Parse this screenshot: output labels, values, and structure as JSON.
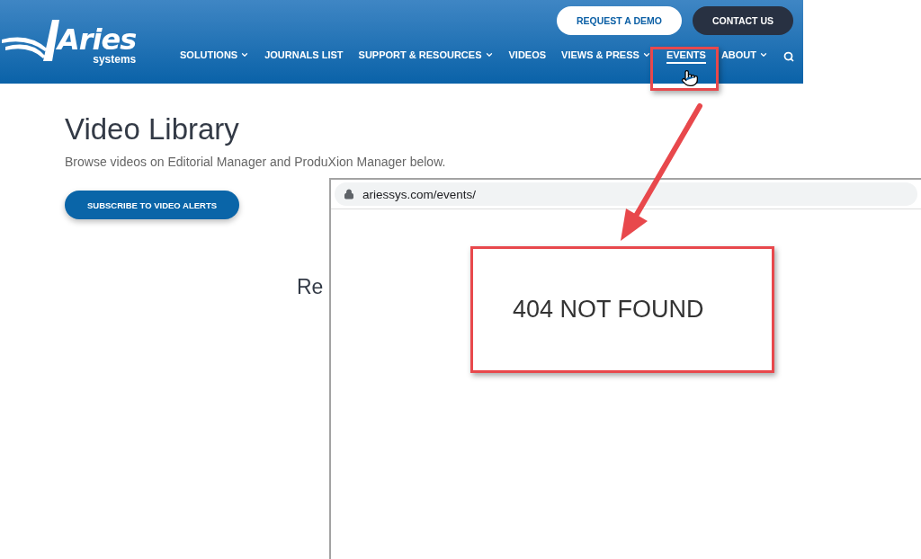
{
  "header": {
    "logo": {
      "name": "Aries",
      "tagline": "systems"
    },
    "buttons": [
      {
        "label": "REQUEST A DEMO",
        "kind": "light"
      },
      {
        "label": "CONTACT US",
        "kind": "dark"
      }
    ],
    "nav": [
      {
        "label": "SOLUTIONS",
        "dropdown": true,
        "selected": false
      },
      {
        "label": "JOURNALS LIST",
        "dropdown": false,
        "selected": false
      },
      {
        "label": "SUPPORT & RESOURCES",
        "dropdown": true,
        "selected": false
      },
      {
        "label": "VIDEOS",
        "dropdown": false,
        "selected": false
      },
      {
        "label": "VIEWS & PRESS",
        "dropdown": true,
        "selected": false
      },
      {
        "label": "EVENTS",
        "dropdown": false,
        "selected": true
      },
      {
        "label": "ABOUT",
        "dropdown": true,
        "selected": false
      }
    ]
  },
  "page": {
    "title": "Video Library",
    "subtitle": "Browse videos on Editorial Manager and ProduXion Manager below.",
    "button": "SUBSCRIBE TO VIDEO ALERTS",
    "section_heading": "Re"
  },
  "popup_window": {
    "url": "ariessys.com/events/",
    "message": "404 NOT FOUND"
  }
}
